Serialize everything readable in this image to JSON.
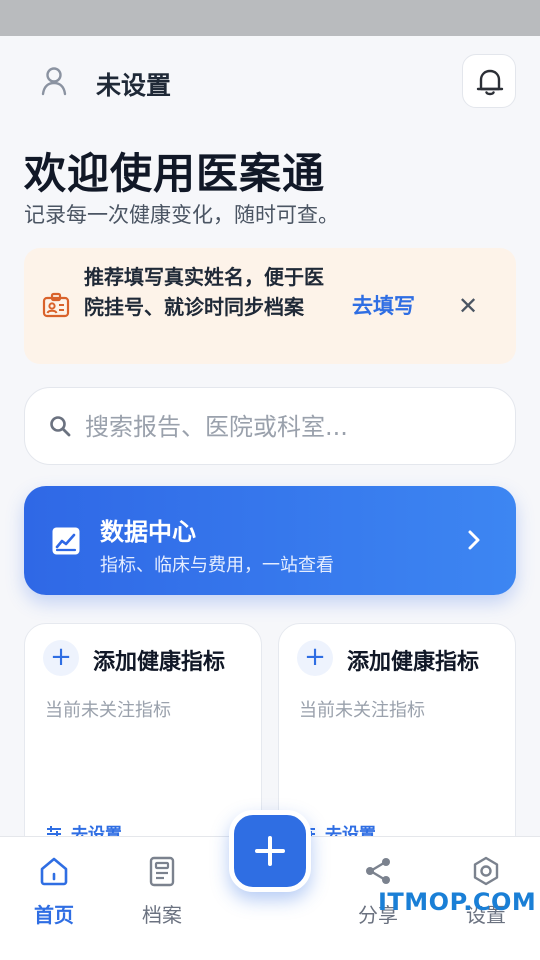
{
  "header": {
    "user_name": "未设置"
  },
  "welcome": {
    "title": "欢迎使用医案通",
    "subtitle": "记录每一次健康变化，随时可查。"
  },
  "notice": {
    "text": "推荐填写真实姓名，便于医院挂号、就诊时同步档案",
    "action": "去填写",
    "close": "✕"
  },
  "search": {
    "placeholder": "搜索报告、医院或科室..."
  },
  "data_center": {
    "title": "数据中心",
    "subtitle": "指标、临床与费用，一站查看"
  },
  "cards": [
    {
      "title": "添加健康指标",
      "desc": "当前未关注指标",
      "action": "去设置"
    },
    {
      "title": "添加健康指标",
      "desc": "当前未关注指标",
      "action": "去设置"
    }
  ],
  "tabs": [
    {
      "label": "首页",
      "icon": "home-icon",
      "active": true
    },
    {
      "label": "档案",
      "icon": "document-icon",
      "active": false
    },
    {
      "label": "分享",
      "icon": "share-icon",
      "active": false
    },
    {
      "label": "设置",
      "icon": "gear-icon",
      "active": false
    }
  ],
  "watermark": "ITMOP.COM",
  "colors": {
    "accent": "#2f6ee3",
    "notice_bg": "#fdf3e9",
    "notice_icon": "#d9622b"
  }
}
